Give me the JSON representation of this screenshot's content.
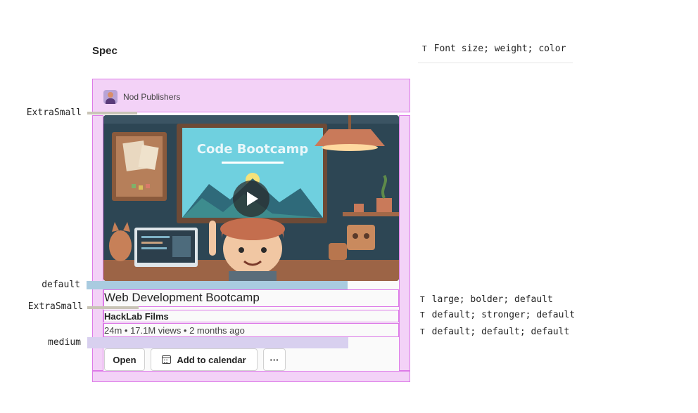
{
  "spec_title": "Spec",
  "legend": {
    "icon": "T",
    "text": "Font size; weight; color"
  },
  "publisher": {
    "name": "Nod Publishers",
    "avatar_icon": "person-avatar-icon"
  },
  "thumbnail": {
    "headline": "Code Bootcamp",
    "play_icon": "play-icon"
  },
  "card": {
    "title": "Web Development Bootcamp",
    "subtitle": "HackLab Films",
    "meta": "24m • 17.1M views • 2 months ago"
  },
  "actions": {
    "open_label": "Open",
    "calendar_label": "Add to calendar",
    "calendar_icon": "calendar-icon",
    "more_label": "···"
  },
  "spacing_labels": {
    "header_gap": "ExtraSmall",
    "image_gap": "default",
    "text_gap": "ExtraSmall",
    "actions_gap": "medium"
  },
  "typography": {
    "title": {
      "icon": "T",
      "text": "large; bolder; default"
    },
    "subtitle": {
      "icon": "T",
      "text": "default; stronger; default"
    },
    "meta": {
      "icon": "T",
      "text": "default; default; default"
    }
  },
  "colors": {
    "spec_fill": "#f3d2f7",
    "spec_outline": "#dd7be8",
    "gap_gray": "#c9c4b6",
    "gap_blue": "#a9cbe0",
    "gap_lavender": "#d8d0ef"
  }
}
